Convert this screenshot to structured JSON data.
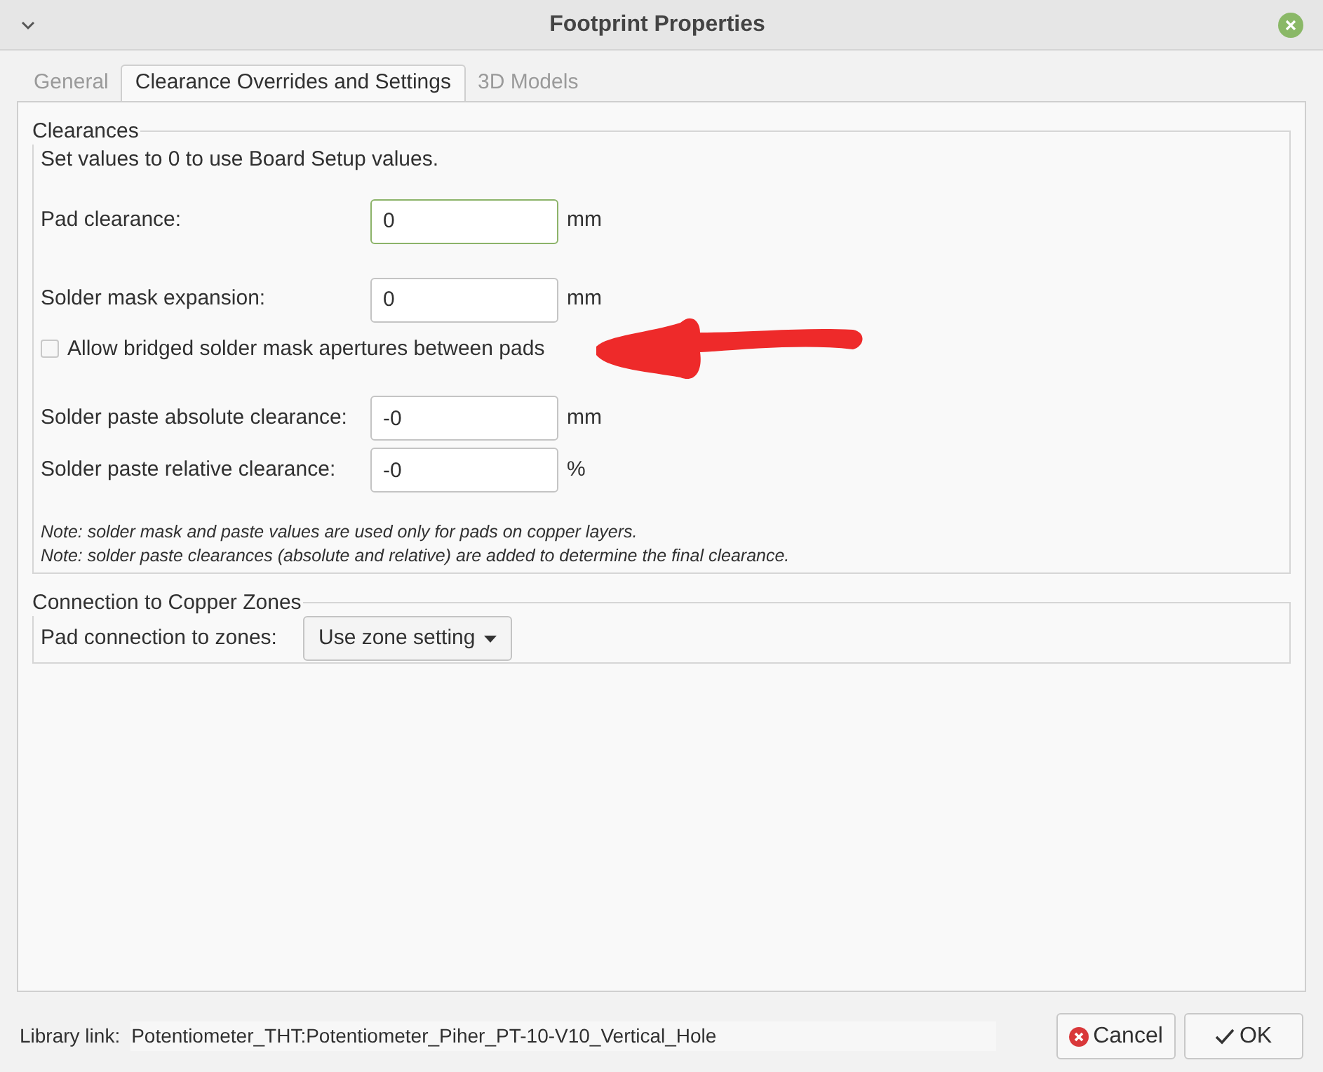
{
  "window": {
    "title": "Footprint Properties"
  },
  "tabs": [
    {
      "label": "General",
      "selected": false,
      "disabled": true
    },
    {
      "label": "Clearance Overrides and Settings",
      "selected": true,
      "disabled": false
    },
    {
      "label": "3D Models",
      "selected": false,
      "disabled": true
    }
  ],
  "clearances": {
    "title": "Clearances",
    "intro": "Set values to 0 to use Board Setup values.",
    "items": [
      {
        "kind": "field",
        "label": "Pad clearance:",
        "value": "0",
        "unit": "mm",
        "focused": true
      },
      {
        "kind": "field",
        "label": "Solder mask expansion:",
        "value": "0",
        "unit": "mm",
        "focused": false
      },
      {
        "kind": "checkbox",
        "label": "Allow bridged solder mask apertures between pads",
        "checked": false
      },
      {
        "kind": "field",
        "label": "Solder paste absolute clearance:",
        "value": "-0",
        "unit": "mm",
        "focused": false
      },
      {
        "kind": "field",
        "label": "Solder paste relative clearance:",
        "value": "-0",
        "unit": "%",
        "focused": false
      }
    ],
    "notes": [
      "Note: solder mask and paste values are used only for pads on copper layers.",
      "Note: solder paste clearances (absolute and relative) are added to determine the final clearance."
    ]
  },
  "zones": {
    "title": "Connection to Copper Zones",
    "label": "Pad connection to zones:",
    "value": "Use zone setting"
  },
  "library_link": {
    "label": "Library link:",
    "value": "Potentiometer_THT:Potentiometer_Piher_PT-10-V10_Vertical_Hole"
  },
  "buttons": [
    {
      "kind": "cancel",
      "label": "Cancel"
    },
    {
      "kind": "ok",
      "label": "OK"
    }
  ]
}
